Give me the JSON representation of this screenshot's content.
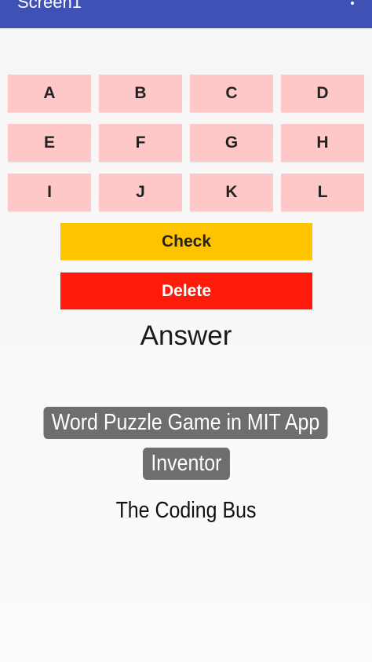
{
  "app_bar": {
    "title": "Screen1",
    "menu_icon": "more-vert-icon",
    "color": "#3f51b5"
  },
  "letter_grid": {
    "button_color": "#ffc8c8",
    "letters": [
      "A",
      "B",
      "C",
      "D",
      "E",
      "F",
      "G",
      "H",
      "I",
      "J",
      "K",
      "L"
    ]
  },
  "actions": {
    "check_label": "Check",
    "check_color": "#ffc400",
    "delete_label": "Delete",
    "delete_color": "#ff1a0a"
  },
  "answer": {
    "text": "Answer"
  },
  "overlay": {
    "caption_line1": "Word Puzzle Game in MIT App",
    "caption_line2": "Inventor",
    "credit": "The Coding Bus"
  }
}
